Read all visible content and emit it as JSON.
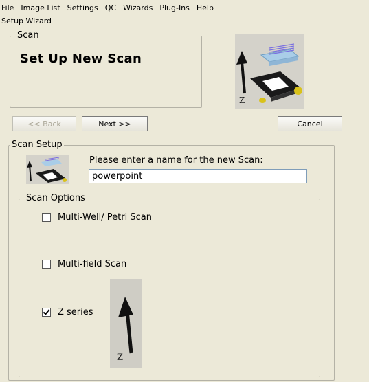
{
  "menubar": {
    "items": [
      {
        "label": "File"
      },
      {
        "label": "Image List"
      },
      {
        "label": "Settings"
      },
      {
        "label": "QC"
      },
      {
        "label": "Wizards"
      },
      {
        "label": "Plug-Ins"
      },
      {
        "label": "Help"
      }
    ]
  },
  "wizard": {
    "title": "Setup Wizard",
    "scan_group_label": "Scan",
    "heading": "Set Up New Scan",
    "back_label": "<< Back",
    "next_label": "Next >>",
    "cancel_label": "Cancel"
  },
  "scan_setup": {
    "group_label": "Scan Setup",
    "prompt": "Please enter a name for the new Scan:",
    "name_value": "powerpoint"
  },
  "scan_options": {
    "group_label": "Scan Options",
    "multiwell_label": "Multi-Well/ Petri Scan",
    "multiwell_checked": false,
    "multifield_label": "Multi-field Scan",
    "multifield_checked": false,
    "zseries_label": "Z series",
    "zseries_checked": true
  },
  "illustration": {
    "axis_label": "Z"
  },
  "colors": {
    "background": "#ece9d8",
    "stage": "#1a1a1a",
    "accent": "#d9c21a"
  }
}
